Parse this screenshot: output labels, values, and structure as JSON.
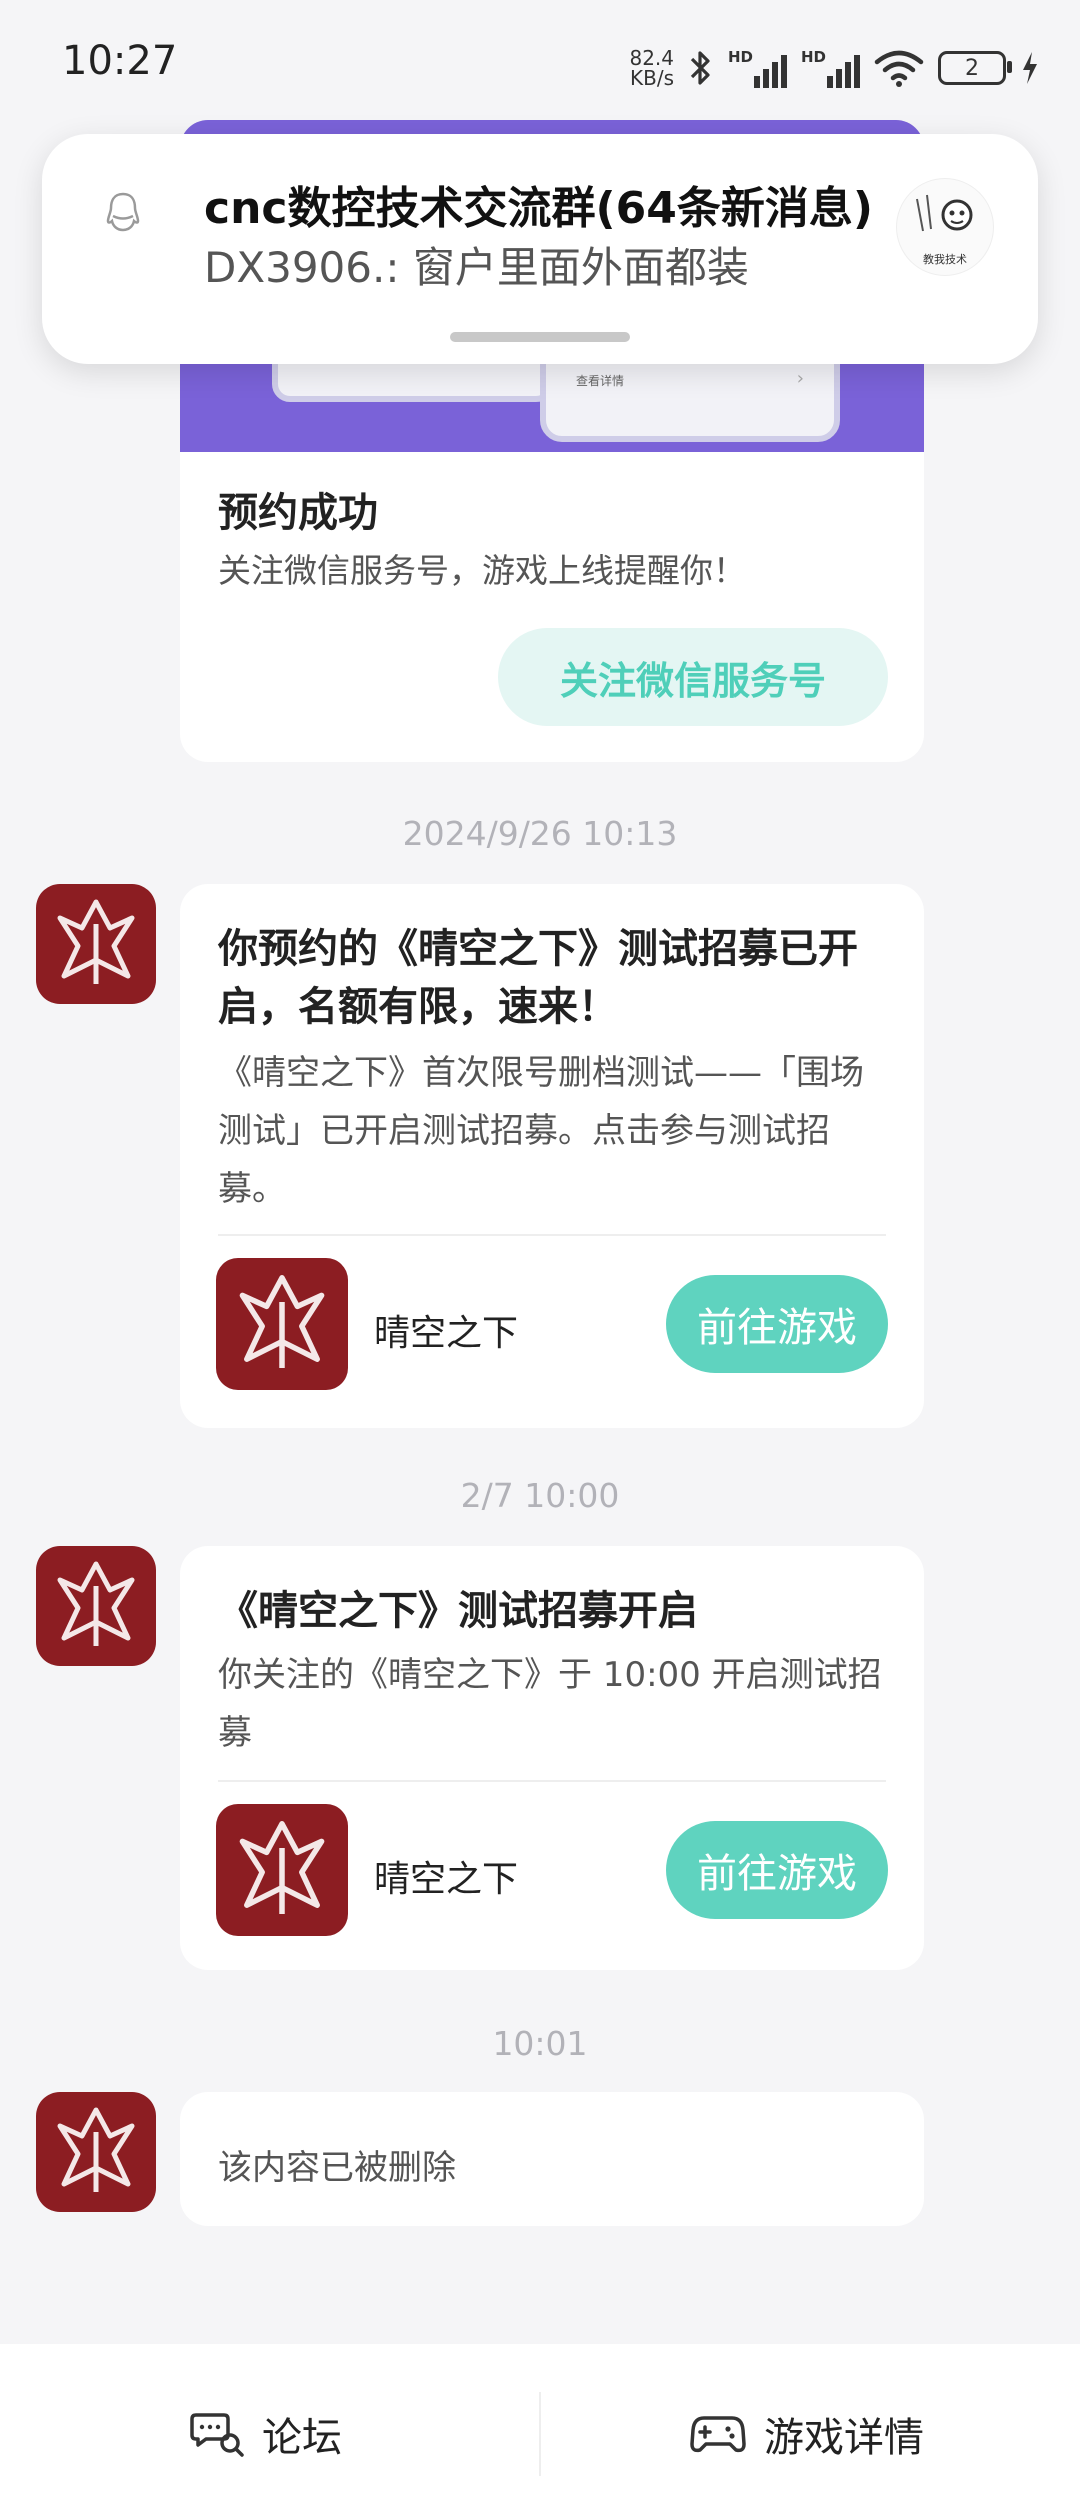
{
  "status_bar": {
    "time": "10:27",
    "net_speed_value": "82.4",
    "net_speed_unit": "KB/s",
    "hd1": "HD",
    "hd2": "HD",
    "battery": "2"
  },
  "notification": {
    "title": "cnc数控技术交流群(64条新消息)",
    "body": "DX3906.: 窗户里面外面都装",
    "avatar_caption": "教我技术",
    "app_icon": "qq-icon"
  },
  "reservation_card": {
    "banner_detail": "查看详情",
    "title": "预约成功",
    "description": "关注微信服务号，游戏上线提醒你！",
    "button": "关注微信服务号"
  },
  "messages": [
    {
      "timestamp": "2024/9/26  10:13",
      "title": "你预约的《晴空之下》测试招募已开启，名额有限，速来！",
      "text": "《晴空之下》首次限号删档测试——「围场测试」已开启测试招募。点击参与测试招募。",
      "game_name": "晴空之下",
      "button": "前往游戏"
    },
    {
      "timestamp": "2/7  10:00",
      "title": "《晴空之下》测试招募开启",
      "text": "你关注的《晴空之下》于 10:00 开启测试招募",
      "game_name": "晴空之下",
      "button": "前往游戏"
    },
    {
      "timestamp": "10:01",
      "deleted_text": "该内容已被删除"
    }
  ],
  "bottom_bar": {
    "forum": "论坛",
    "game_detail": "游戏详情"
  },
  "colors": {
    "accent": "#5fd3bf",
    "banner": "#7a62d8",
    "game_icon": "#8c1d22"
  }
}
